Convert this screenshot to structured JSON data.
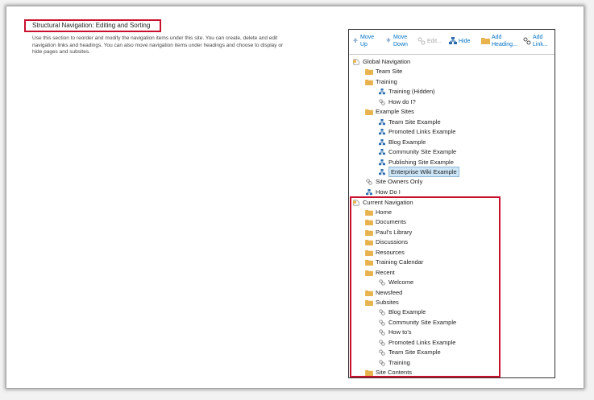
{
  "section": {
    "title": "Structural Navigation: Editing and Sorting",
    "description": "Use this section to reorder and modify the navigation items under this site. You can create, delete and edit navigation links and headings. You can also move navigation items under headings and choose to display or hide pages and subsites."
  },
  "toolbar": {
    "move_up_1": "Move",
    "move_up_2": "Up",
    "move_down_1": "Move",
    "move_down_2": "Down",
    "edit": "Edit...",
    "hide": "Hide",
    "add_heading_1": "Add",
    "add_heading_2": "Heading...",
    "add_link_1": "Add",
    "add_link_2": "Link..."
  },
  "colors": {
    "accent": "#0072c6",
    "highlight_border": "#c8102e",
    "folder": "#e8b34e"
  },
  "tree": {
    "global": {
      "label": "Global Navigation",
      "items": [
        "Team Site",
        "Training",
        "Training (Hidden)",
        "How do I?",
        "Example Sites",
        "Team Site Example",
        "Promoted Links Example",
        "Blog Example",
        "Community Site Example",
        "Publishing Site Example",
        "Enterprise Wiki Example",
        "Site Owners Only",
        "How Do I"
      ]
    },
    "current": {
      "label": "Current Navigation",
      "items": [
        "Home",
        "Documents",
        "Paul's Library",
        "Discussions",
        "Resources",
        "Training Calendar",
        "Recent",
        "Welcome",
        "Newsfeed",
        "Subsites",
        "Blog Example",
        "Community Site Example",
        "How to's",
        "Promoted Links Example",
        "Team Site Example",
        "Training",
        "Site Contents"
      ]
    }
  }
}
